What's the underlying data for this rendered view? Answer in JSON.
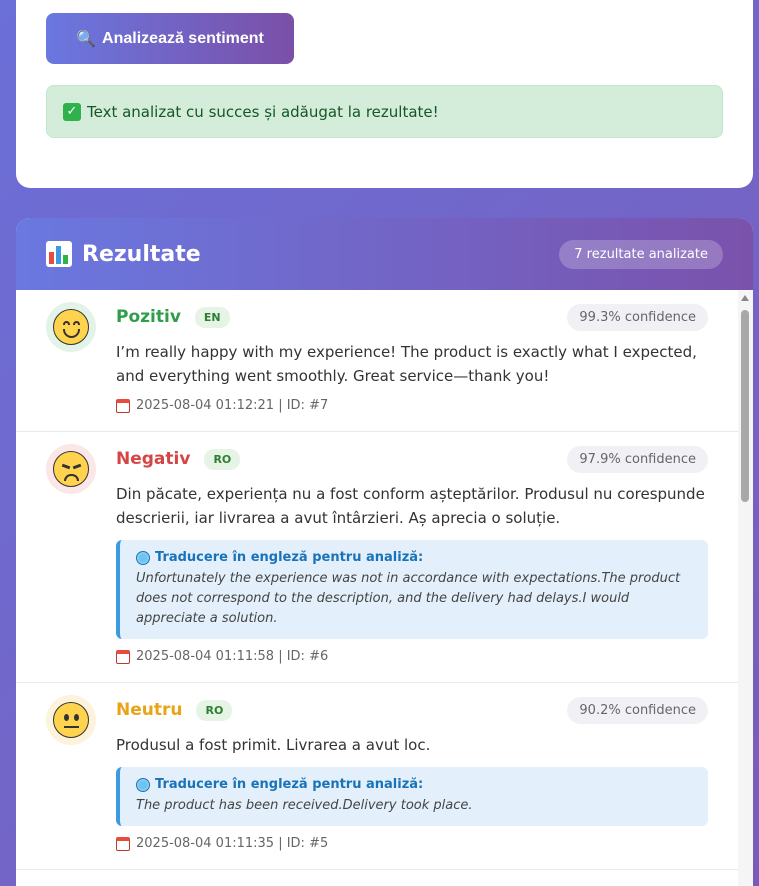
{
  "analyze_button": {
    "label": "Analizează sentiment",
    "icon": "search-icon"
  },
  "success_message": "Text analizat cu succes și adăugat la rezultate!",
  "results": {
    "title": "Rezultate",
    "count_label": "7 rezultate analizate",
    "items": [
      {
        "sentiment": "Pozitiv",
        "color": "#2e9e4a",
        "face_bg": "#e3f3e8",
        "lang": "EN",
        "confidence": "99.3% confidence",
        "text": "I’m really happy with my experience! The product is exactly what I expected, and everything went smoothly. Great service—thank you!",
        "meta": "2025-08-04 01:12:21 | ID: #7"
      },
      {
        "sentiment": "Negativ",
        "color": "#d64545",
        "face_bg": "#fbe6e8",
        "lang": "RO",
        "confidence": "97.9% confidence",
        "text": "Din păcate, experiența nu a fost conform așteptărilor. Produsul nu corespunde descrierii, iar livrarea a avut întârzieri. Aș aprecia o soluție.",
        "translation_title": "Traducere în engleză pentru analiză:",
        "translation": "Unfortunately the experience was not in accordance with expectations.The product does not correspond to the description, and the delivery had delays.I would appreciate a solution.",
        "meta": "2025-08-04 01:11:58 | ID: #6"
      },
      {
        "sentiment": "Neutru",
        "color": "#e8a317",
        "face_bg": "#fdf3dc",
        "lang": "RO",
        "confidence": "90.2% confidence",
        "text": "Produsul a fost primit. Livrarea a avut loc.",
        "translation_title": "Traducere în engleză pentru analiză:",
        "translation": "The product has been received.Delivery took place.",
        "meta": "2025-08-04 01:11:35 | ID: #5"
      }
    ]
  }
}
